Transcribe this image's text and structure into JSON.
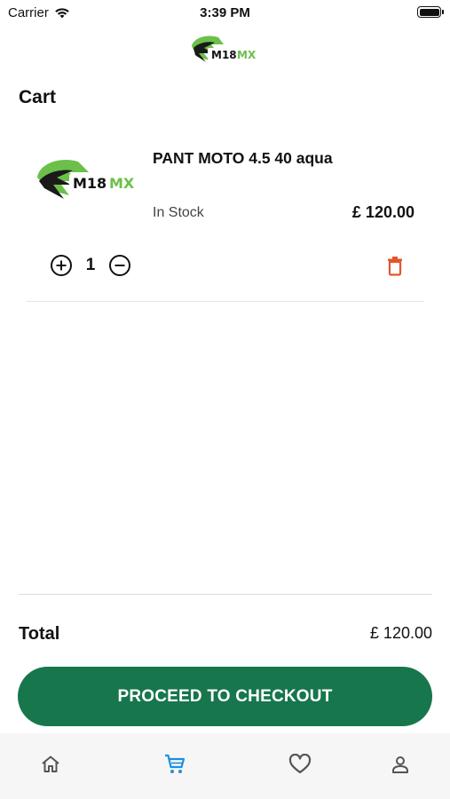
{
  "status_bar": {
    "carrier": "Carrier",
    "time": "3:39 PM"
  },
  "header": {
    "logo_text_left": "M18",
    "logo_text_right": "MX"
  },
  "page": {
    "title": "Cart"
  },
  "cart": {
    "items": [
      {
        "name": "PANT MOTO 4.5 40 aqua",
        "stock": "In Stock",
        "price": "£ 120.00",
        "quantity": "1",
        "logo_text_left": "M18",
        "logo_text_right": "MX"
      }
    ]
  },
  "summary": {
    "total_label": "Total",
    "total_value": "£ 120.00"
  },
  "checkout": {
    "label": "PROCEED TO CHECKOUT"
  },
  "tab_bar": {
    "items": [
      {
        "icon": "home-icon",
        "active": false
      },
      {
        "icon": "cart-icon",
        "active": true
      },
      {
        "icon": "heart-icon",
        "active": false
      },
      {
        "icon": "person-icon",
        "active": false
      }
    ]
  },
  "colors": {
    "brand_green": "#17764b",
    "logo_green": "#6cc04a",
    "active_tab": "#1e8fe1",
    "inactive_tab": "#555555",
    "delete_red": "#e2552e"
  }
}
